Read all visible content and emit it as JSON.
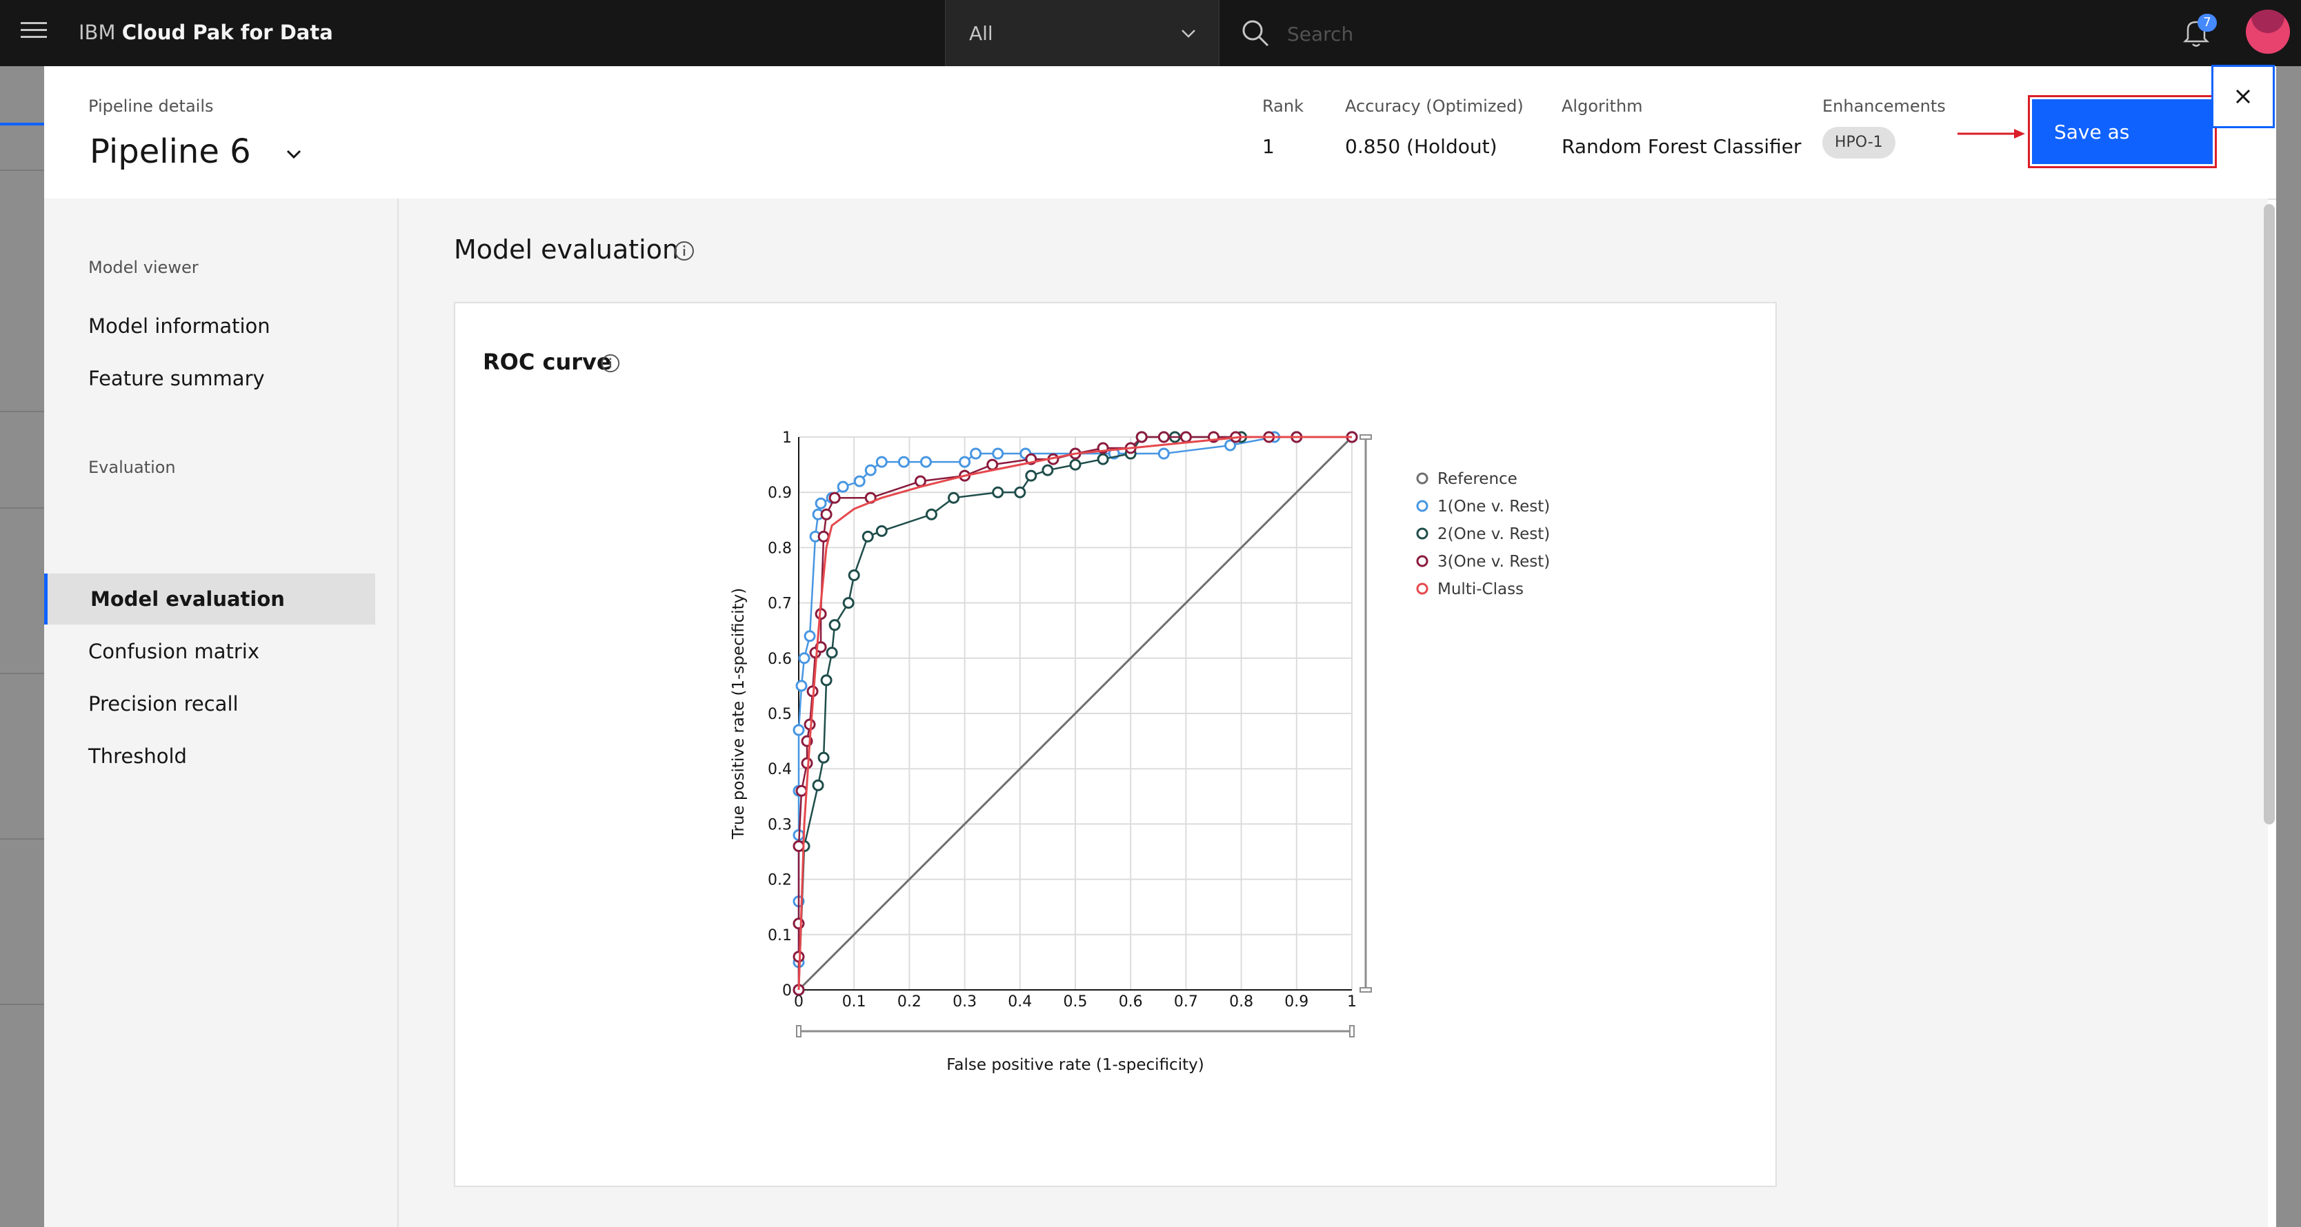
{
  "shell": {
    "brand_light": "IBM",
    "brand_bold": "Cloud Pak for Data",
    "scope_value": "All",
    "search_placeholder": "Search",
    "notification_count": "7"
  },
  "header": {
    "pipeline_label": "Pipeline details",
    "pipeline_name": "Pipeline 6",
    "rank_label": "Rank",
    "rank_value": "1",
    "accuracy_label": "Accuracy  (Optimized)",
    "accuracy_value": "0.850 (Holdout)",
    "algorithm_label": "Algorithm",
    "algorithm_value": "Random Forest Classifier",
    "enhancements_label": "Enhancements",
    "enhancement_tag": "HPO-1",
    "save_label": "Save as"
  },
  "sidebar": {
    "section1": "Model viewer",
    "items1": [
      "Model information",
      "Feature summary"
    ],
    "section2": "Evaluation",
    "active": "Model evaluation",
    "items2": [
      "Confusion matrix",
      "Precision recall",
      "Threshold"
    ]
  },
  "main": {
    "title": "Model evaluation",
    "card_title": "ROC curve"
  },
  "colors": {
    "primary": "#0f62fe",
    "reference": "#6f6f6f",
    "class1": "#4796e2",
    "class2": "#1e4d4a",
    "class3": "#8a1b3d",
    "multiclass": "#e5484d",
    "annotation": "#da1e28"
  },
  "chart_data": {
    "type": "line",
    "title": "ROC curve",
    "xlabel": "False positive rate (1-specificity)",
    "ylabel": "True positive rate (1-specificity)",
    "xlim": [
      0,
      1
    ],
    "ylim": [
      0,
      1
    ],
    "xticks": [
      "0",
      "0.1",
      "0.2",
      "0.3",
      "0.4",
      "0.5",
      "0.6",
      "0.7",
      "0.8",
      "0.9",
      "1"
    ],
    "yticks": [
      "0",
      "0.1",
      "0.2",
      "0.3",
      "0.4",
      "0.5",
      "0.6",
      "0.7",
      "0.8",
      "0.9",
      "1"
    ],
    "grid": true,
    "legend_position": "right",
    "series": [
      {
        "name": "Reference",
        "color": "#6f6f6f",
        "markers": false,
        "points": [
          [
            0,
            0
          ],
          [
            1,
            1
          ]
        ]
      },
      {
        "name": "1(One v. Rest)",
        "color": "#4796e2",
        "markers": true,
        "points": [
          [
            0,
            0
          ],
          [
            0,
            0.05
          ],
          [
            0,
            0.16
          ],
          [
            0,
            0.28
          ],
          [
            0,
            0.36
          ],
          [
            0,
            0.47
          ],
          [
            0.005,
            0.55
          ],
          [
            0.01,
            0.6
          ],
          [
            0.02,
            0.64
          ],
          [
            0.03,
            0.82
          ],
          [
            0.035,
            0.86
          ],
          [
            0.04,
            0.88
          ],
          [
            0.06,
            0.89
          ],
          [
            0.08,
            0.91
          ],
          [
            0.11,
            0.92
          ],
          [
            0.13,
            0.94
          ],
          [
            0.15,
            0.955
          ],
          [
            0.19,
            0.955
          ],
          [
            0.23,
            0.955
          ],
          [
            0.3,
            0.955
          ],
          [
            0.32,
            0.97
          ],
          [
            0.36,
            0.97
          ],
          [
            0.41,
            0.97
          ],
          [
            0.5,
            0.97
          ],
          [
            0.57,
            0.97
          ],
          [
            0.66,
            0.97
          ],
          [
            0.78,
            0.985
          ],
          [
            0.86,
            1
          ],
          [
            0.9,
            1
          ],
          [
            1,
            1
          ]
        ]
      },
      {
        "name": "2(One v. Rest)",
        "color": "#1e4d4a",
        "markers": true,
        "points": [
          [
            0,
            0
          ],
          [
            0.01,
            0.26
          ],
          [
            0.035,
            0.37
          ],
          [
            0.045,
            0.42
          ],
          [
            0.05,
            0.56
          ],
          [
            0.06,
            0.61
          ],
          [
            0.065,
            0.66
          ],
          [
            0.09,
            0.7
          ],
          [
            0.1,
            0.75
          ],
          [
            0.125,
            0.82
          ],
          [
            0.15,
            0.83
          ],
          [
            0.24,
            0.86
          ],
          [
            0.28,
            0.89
          ],
          [
            0.36,
            0.9
          ],
          [
            0.4,
            0.9
          ],
          [
            0.42,
            0.93
          ],
          [
            0.45,
            0.94
          ],
          [
            0.5,
            0.95
          ],
          [
            0.55,
            0.96
          ],
          [
            0.6,
            0.97
          ],
          [
            0.62,
            1
          ],
          [
            0.68,
            1
          ],
          [
            0.8,
            1
          ],
          [
            0.9,
            1
          ],
          [
            1,
            1
          ]
        ]
      },
      {
        "name": "3(One v. Rest)",
        "color": "#8a1b3d",
        "markers": true,
        "points": [
          [
            0,
            0
          ],
          [
            0,
            0.06
          ],
          [
            0,
            0.12
          ],
          [
            0,
            0.26
          ],
          [
            0.005,
            0.36
          ],
          [
            0.015,
            0.41
          ],
          [
            0.015,
            0.45
          ],
          [
            0.02,
            0.48
          ],
          [
            0.025,
            0.54
          ],
          [
            0.03,
            0.61
          ],
          [
            0.04,
            0.62
          ],
          [
            0.04,
            0.68
          ],
          [
            0.045,
            0.82
          ],
          [
            0.05,
            0.86
          ],
          [
            0.065,
            0.89
          ],
          [
            0.13,
            0.89
          ],
          [
            0.22,
            0.92
          ],
          [
            0.3,
            0.93
          ],
          [
            0.35,
            0.95
          ],
          [
            0.42,
            0.96
          ],
          [
            0.46,
            0.96
          ],
          [
            0.5,
            0.97
          ],
          [
            0.55,
            0.98
          ],
          [
            0.6,
            0.98
          ],
          [
            0.62,
            1
          ],
          [
            0.66,
            1
          ],
          [
            0.7,
            1
          ],
          [
            0.75,
            1
          ],
          [
            0.79,
            1
          ],
          [
            0.85,
            1
          ],
          [
            0.9,
            1
          ],
          [
            1,
            1
          ]
        ]
      },
      {
        "name": "Multi-Class",
        "color": "#e5484d",
        "markers": false,
        "points": [
          [
            0,
            0
          ],
          [
            0.01,
            0.3
          ],
          [
            0.02,
            0.45
          ],
          [
            0.03,
            0.58
          ],
          [
            0.04,
            0.7
          ],
          [
            0.05,
            0.8
          ],
          [
            0.06,
            0.84
          ],
          [
            0.1,
            0.87
          ],
          [
            0.15,
            0.89
          ],
          [
            0.22,
            0.91
          ],
          [
            0.3,
            0.93
          ],
          [
            0.4,
            0.95
          ],
          [
            0.5,
            0.97
          ],
          [
            0.6,
            0.98
          ],
          [
            0.7,
            0.99
          ],
          [
            0.8,
            1
          ],
          [
            0.9,
            1
          ],
          [
            1,
            1
          ]
        ]
      }
    ]
  }
}
